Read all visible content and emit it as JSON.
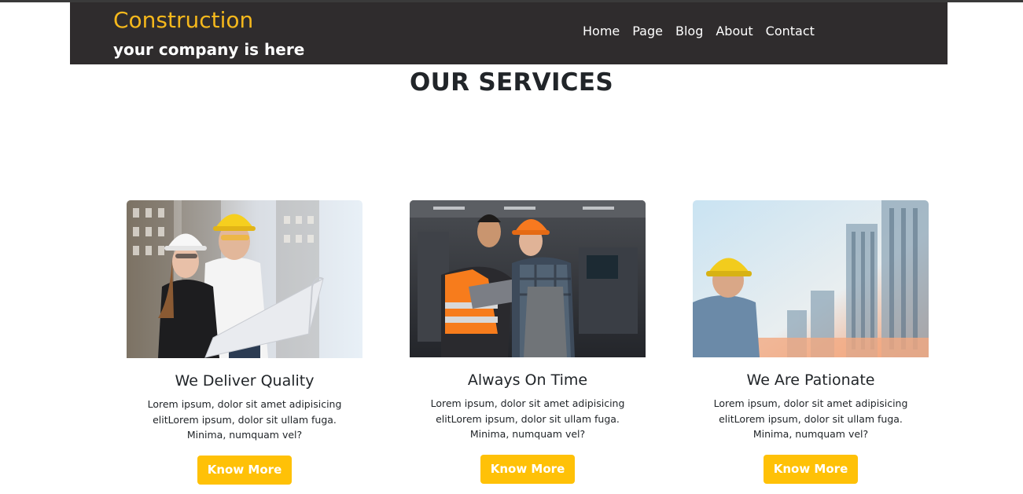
{
  "header": {
    "brand_title": "Construction",
    "brand_subtitle": "your company is here",
    "nav": [
      "Home",
      "Page",
      "Blog",
      "About",
      "Contact"
    ]
  },
  "services": {
    "title": "OUR SERVICES",
    "cards": [
      {
        "title": "We Deliver Quality",
        "text": "Lorem ipsum, dolor sit amet adipisicing elitLorem ipsum, dolor sit ullam fuga. Minima, numquam vel?",
        "button": "Know More"
      },
      {
        "title": "Always On Time",
        "text": "Lorem ipsum, dolor sit amet adipisicing elitLorem ipsum, dolor sit ullam fuga. Minima, numquam vel?",
        "button": "Know More"
      },
      {
        "title": "We Are Pationate",
        "text": "Lorem ipsum, dolor sit amet adipisicing elitLorem ipsum, dolor sit ullam fuga. Minima, numquam vel?",
        "button": "Know More"
      }
    ]
  },
  "colors": {
    "navbar_bg": "#2f2c2d",
    "brand_accent": "#f5b81c",
    "button_bg": "#ffc107",
    "text": "#212529"
  }
}
